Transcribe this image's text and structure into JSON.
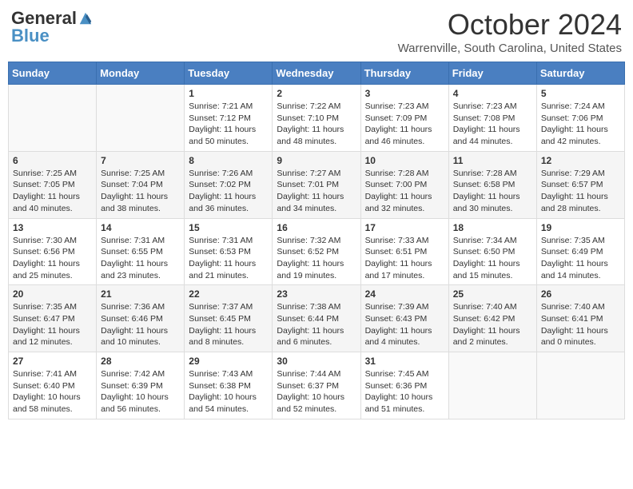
{
  "header": {
    "logo_general": "General",
    "logo_blue": "Blue",
    "month_title": "October 2024",
    "location": "Warrenville, South Carolina, United States"
  },
  "days_of_week": [
    "Sunday",
    "Monday",
    "Tuesday",
    "Wednesday",
    "Thursday",
    "Friday",
    "Saturday"
  ],
  "weeks": [
    [
      null,
      null,
      {
        "day": 1,
        "sunrise": "7:21 AM",
        "sunset": "7:12 PM",
        "daylight": "11 hours and 50 minutes."
      },
      {
        "day": 2,
        "sunrise": "7:22 AM",
        "sunset": "7:10 PM",
        "daylight": "11 hours and 48 minutes."
      },
      {
        "day": 3,
        "sunrise": "7:23 AM",
        "sunset": "7:09 PM",
        "daylight": "11 hours and 46 minutes."
      },
      {
        "day": 4,
        "sunrise": "7:23 AM",
        "sunset": "7:08 PM",
        "daylight": "11 hours and 44 minutes."
      },
      {
        "day": 5,
        "sunrise": "7:24 AM",
        "sunset": "7:06 PM",
        "daylight": "11 hours and 42 minutes."
      }
    ],
    [
      {
        "day": 6,
        "sunrise": "7:25 AM",
        "sunset": "7:05 PM",
        "daylight": "11 hours and 40 minutes."
      },
      {
        "day": 7,
        "sunrise": "7:25 AM",
        "sunset": "7:04 PM",
        "daylight": "11 hours and 38 minutes."
      },
      {
        "day": 8,
        "sunrise": "7:26 AM",
        "sunset": "7:02 PM",
        "daylight": "11 hours and 36 minutes."
      },
      {
        "day": 9,
        "sunrise": "7:27 AM",
        "sunset": "7:01 PM",
        "daylight": "11 hours and 34 minutes."
      },
      {
        "day": 10,
        "sunrise": "7:28 AM",
        "sunset": "7:00 PM",
        "daylight": "11 hours and 32 minutes."
      },
      {
        "day": 11,
        "sunrise": "7:28 AM",
        "sunset": "6:58 PM",
        "daylight": "11 hours and 30 minutes."
      },
      {
        "day": 12,
        "sunrise": "7:29 AM",
        "sunset": "6:57 PM",
        "daylight": "11 hours and 28 minutes."
      }
    ],
    [
      {
        "day": 13,
        "sunrise": "7:30 AM",
        "sunset": "6:56 PM",
        "daylight": "11 hours and 25 minutes."
      },
      {
        "day": 14,
        "sunrise": "7:31 AM",
        "sunset": "6:55 PM",
        "daylight": "11 hours and 23 minutes."
      },
      {
        "day": 15,
        "sunrise": "7:31 AM",
        "sunset": "6:53 PM",
        "daylight": "11 hours and 21 minutes."
      },
      {
        "day": 16,
        "sunrise": "7:32 AM",
        "sunset": "6:52 PM",
        "daylight": "11 hours and 19 minutes."
      },
      {
        "day": 17,
        "sunrise": "7:33 AM",
        "sunset": "6:51 PM",
        "daylight": "11 hours and 17 minutes."
      },
      {
        "day": 18,
        "sunrise": "7:34 AM",
        "sunset": "6:50 PM",
        "daylight": "11 hours and 15 minutes."
      },
      {
        "day": 19,
        "sunrise": "7:35 AM",
        "sunset": "6:49 PM",
        "daylight": "11 hours and 14 minutes."
      }
    ],
    [
      {
        "day": 20,
        "sunrise": "7:35 AM",
        "sunset": "6:47 PM",
        "daylight": "11 hours and 12 minutes."
      },
      {
        "day": 21,
        "sunrise": "7:36 AM",
        "sunset": "6:46 PM",
        "daylight": "11 hours and 10 minutes."
      },
      {
        "day": 22,
        "sunrise": "7:37 AM",
        "sunset": "6:45 PM",
        "daylight": "11 hours and 8 minutes."
      },
      {
        "day": 23,
        "sunrise": "7:38 AM",
        "sunset": "6:44 PM",
        "daylight": "11 hours and 6 minutes."
      },
      {
        "day": 24,
        "sunrise": "7:39 AM",
        "sunset": "6:43 PM",
        "daylight": "11 hours and 4 minutes."
      },
      {
        "day": 25,
        "sunrise": "7:40 AM",
        "sunset": "6:42 PM",
        "daylight": "11 hours and 2 minutes."
      },
      {
        "day": 26,
        "sunrise": "7:40 AM",
        "sunset": "6:41 PM",
        "daylight": "11 hours and 0 minutes."
      }
    ],
    [
      {
        "day": 27,
        "sunrise": "7:41 AM",
        "sunset": "6:40 PM",
        "daylight": "10 hours and 58 minutes."
      },
      {
        "day": 28,
        "sunrise": "7:42 AM",
        "sunset": "6:39 PM",
        "daylight": "10 hours and 56 minutes."
      },
      {
        "day": 29,
        "sunrise": "7:43 AM",
        "sunset": "6:38 PM",
        "daylight": "10 hours and 54 minutes."
      },
      {
        "day": 30,
        "sunrise": "7:44 AM",
        "sunset": "6:37 PM",
        "daylight": "10 hours and 52 minutes."
      },
      {
        "day": 31,
        "sunrise": "7:45 AM",
        "sunset": "6:36 PM",
        "daylight": "10 hours and 51 minutes."
      },
      null,
      null
    ]
  ],
  "labels": {
    "sunrise": "Sunrise:",
    "sunset": "Sunset:",
    "daylight": "Daylight:"
  }
}
